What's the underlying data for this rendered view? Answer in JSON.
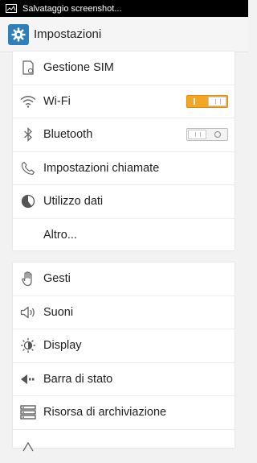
{
  "status_bar": {
    "notification_icon": "image-icon",
    "text": "Salvataggio screenshot..."
  },
  "app_bar": {
    "icon": "gear-icon",
    "title": "Impostazioni"
  },
  "groups": [
    {
      "items": [
        {
          "icon": "sim-card-icon",
          "label": "Gestione SIM"
        },
        {
          "icon": "wifi-icon",
          "label": "Wi-Fi",
          "toggle": "on"
        },
        {
          "icon": "bluetooth-icon",
          "label": "Bluetooth",
          "toggle": "off"
        },
        {
          "icon": "phone-icon",
          "label": "Impostazioni chiamate"
        },
        {
          "icon": "data-usage-icon",
          "label": "Utilizzo dati"
        },
        {
          "icon": "",
          "label": "Altro..."
        }
      ]
    },
    {
      "items": [
        {
          "icon": "hand-gesture-icon",
          "label": "Gesti"
        },
        {
          "icon": "speaker-icon",
          "label": "Suoni"
        },
        {
          "icon": "brightness-icon",
          "label": "Display"
        },
        {
          "icon": "status-bar-icon",
          "label": "Barra di stato"
        },
        {
          "icon": "storage-icon",
          "label": "Risorsa di archiviazione"
        }
      ]
    }
  ],
  "colors": {
    "toggle_on": "#f4a623",
    "app_icon_bg": "#2e7fba"
  }
}
